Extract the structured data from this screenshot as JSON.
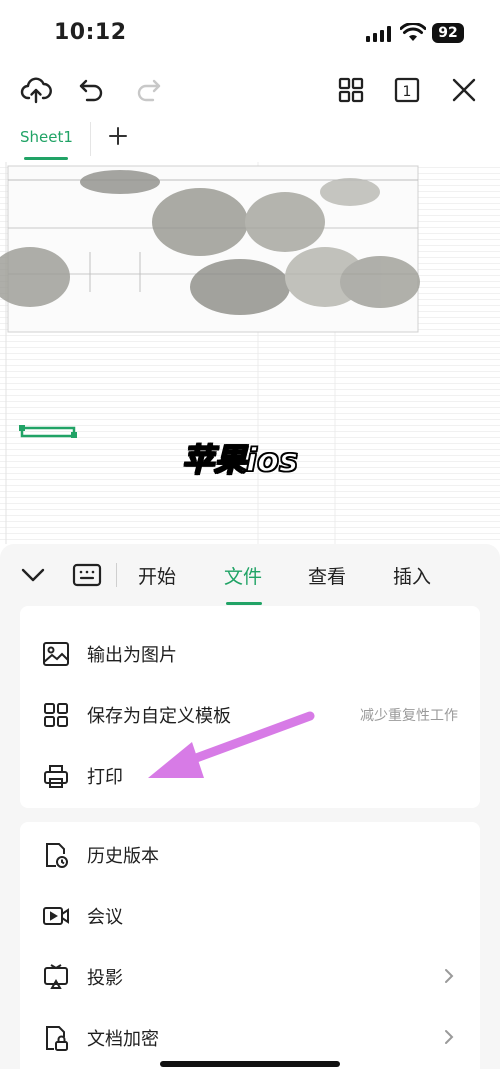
{
  "status_bar": {
    "time": "10:12",
    "battery": "92"
  },
  "toolbar": {
    "icons": [
      "cloud-upload-icon",
      "undo-icon",
      "redo-icon",
      "grid-view-icon",
      "page-count-icon",
      "close-icon"
    ],
    "page_count": "1"
  },
  "sheet_tabs": {
    "active": "Sheet1",
    "add_icon": "plus-icon"
  },
  "watermark": "苹果ios",
  "menu_tabs": {
    "items": [
      "开始",
      "文件",
      "查看",
      "插入"
    ],
    "active": "文件",
    "collapse_icon": "chevron-down-icon",
    "keyboard_icon": "keyboard-icon"
  },
  "file_menu": {
    "group1": [
      {
        "label": "输出为图片",
        "icon": "image-icon"
      },
      {
        "label": "保存为自定义模板",
        "icon": "template-icon",
        "hint": "减少重复性工作"
      },
      {
        "label": "打印",
        "icon": "printer-icon"
      }
    ],
    "group2": [
      {
        "label": "历史版本",
        "icon": "history-icon"
      },
      {
        "label": "会议",
        "icon": "meeting-icon"
      },
      {
        "label": "投影",
        "icon": "projection-icon"
      },
      {
        "label": "文档加密",
        "icon": "lock-document-icon"
      }
    ]
  },
  "colors": {
    "accent": "#21a366",
    "annotation_arrow": "#d77be6",
    "panel_bg": "#f6f6f6"
  }
}
